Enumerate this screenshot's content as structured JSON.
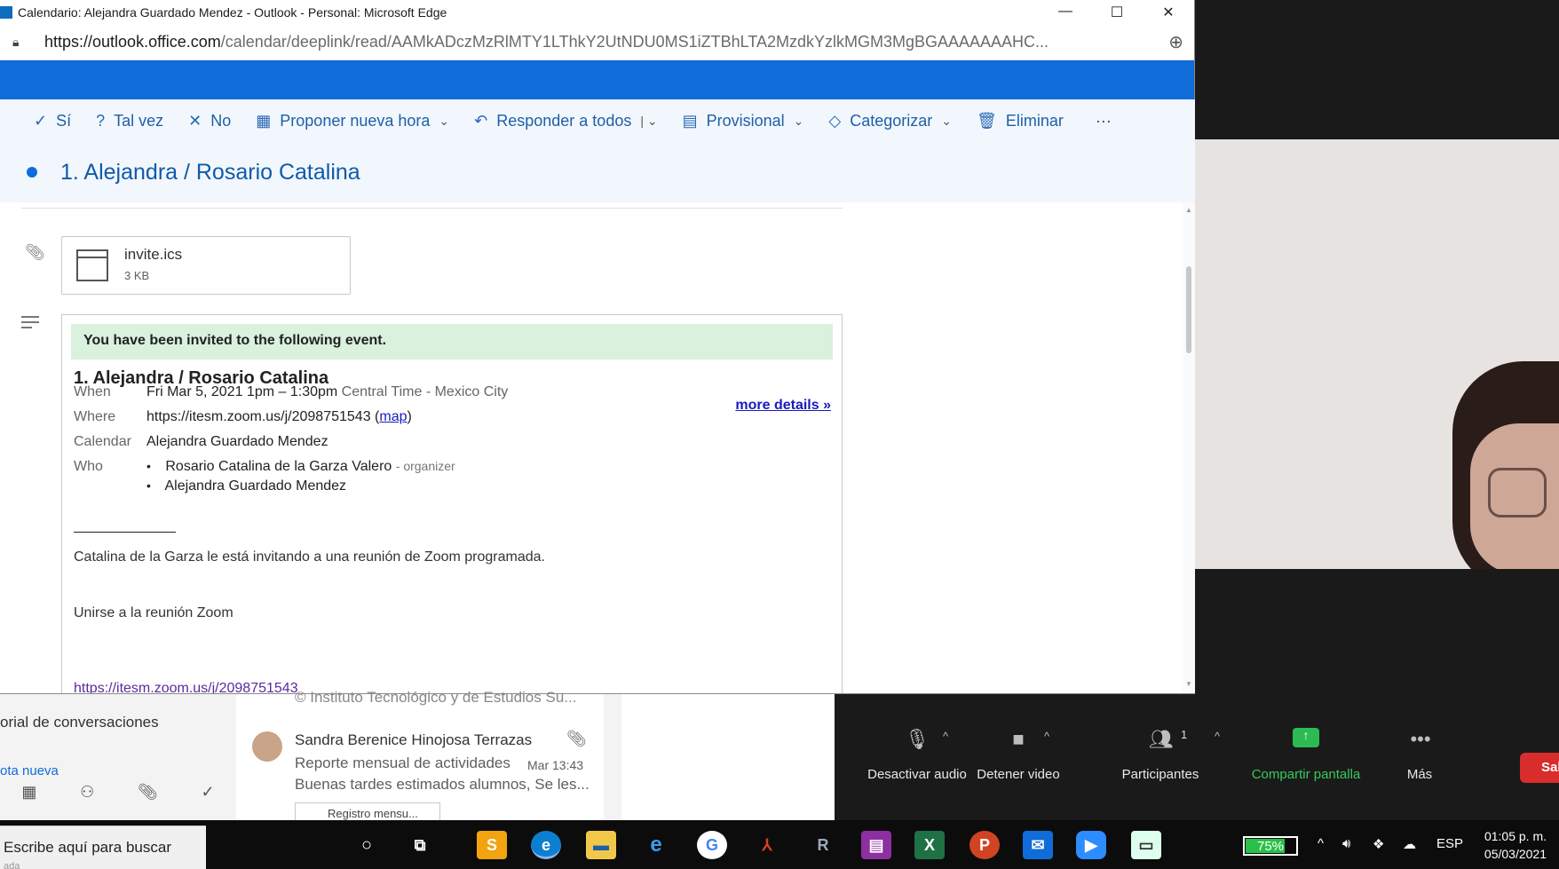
{
  "window": {
    "title": "Calendario: Alejandra Guardado Mendez - Outlook - Personal: Microsoft Edge",
    "url_host": "https://outlook.office.com",
    "url_path": "/calendar/deeplink/read/AAMkADczMzRlMTY1LThkY2UtNDU0MS1iZTBhLTA2MzdkYzlkMGM3MgBGAAAAAAAHC..."
  },
  "commands": {
    "yes": "Sí",
    "maybe": "Tal vez",
    "no": "No",
    "propose": "Proponer nueva hora",
    "reply_all": "Responder a todos",
    "provisional": "Provisional",
    "categorize": "Categorizar",
    "delete": "Eliminar",
    "more": "···"
  },
  "event": {
    "subject": "1. Alejandra / Rosario Catalina"
  },
  "attachment": {
    "name": "invite.ics",
    "size": "3 KB"
  },
  "invite": {
    "banner": "You have been invited to the following event.",
    "title": "1. Alejandra / Rosario Catalina",
    "more_details": "more details »",
    "when_label": "When",
    "when_value": "Fri Mar 5, 2021 1pm – 1:30pm",
    "when_tz": "Central Time - Mexico City",
    "where_label": "Where",
    "where_value": "https://itesm.zoom.us/j/2098751543",
    "where_map": "map",
    "calendar_label": "Calendar",
    "calendar_value": "Alejandra Guardado Mendez",
    "who_label": "Who",
    "guests": [
      {
        "name": "Rosario Catalina de la Garza Valero",
        "role": "- organizer"
      },
      {
        "name": "Alejandra Guardado Mendez",
        "role": ""
      }
    ],
    "message": "Catalina de la Garza le está invitando a una reunión de Zoom programada.",
    "join": "Unirse a la reunión Zoom",
    "join_url": "https://itesm.zoom.us/j/2098751543"
  },
  "behind": {
    "conversation_history": "orial de conversaciones",
    "new_note": "ota nueva",
    "copyright": "© Instituto Tecnológico y de Estudios Su...",
    "sender": "Sandra Berenice Hinojosa Terrazas",
    "subject": "Reporte mensual de actividades",
    "date": "Mar 13:43",
    "preview": "Buenas tardes estimados alumnos, Se les...",
    "chip": "Registro mensu..."
  },
  "zoom": {
    "mute": "Desactivar audio",
    "video": "Detener video",
    "participants": "Participantes",
    "participants_count": "1",
    "share": "Compartir pantalla",
    "more": "Más",
    "leave": "Sal"
  },
  "taskbar": {
    "search": "Escribe aquí para buscar",
    "search_sub": "ada",
    "battery": "75%",
    "battery_level": 0.75,
    "lang": "ESP",
    "time": "01:05 p. m.",
    "date": "05/03/2021"
  }
}
